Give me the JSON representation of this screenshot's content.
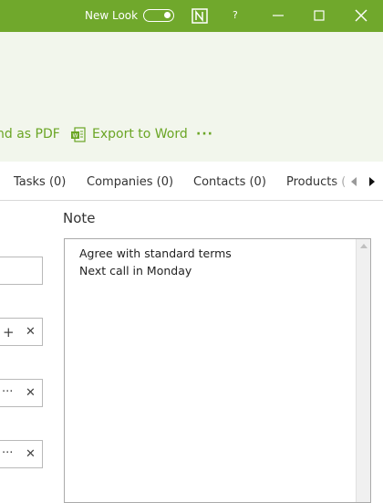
{
  "titlebar": {
    "new_look_label": "New Look",
    "new_look_on": true,
    "help_label": "?",
    "brand_icon": "onenote-like-n-icon",
    "bg_color": "#70a82c"
  },
  "ribbon": {
    "send_pdf_label": "nd as PDF",
    "export_word_label": "Export to Word",
    "more_label": "···",
    "accent_color": "#6aa524"
  },
  "tabs": [
    {
      "label": "Tasks (0)"
    },
    {
      "label": "Companies (0)"
    },
    {
      "label": "Contacts (0)"
    },
    {
      "label": "Products ("
    }
  ],
  "fields": {
    "row2_add": "+",
    "row2_clear": "✕",
    "row3_more": "···",
    "row3_clear": "✕",
    "row4_more": "···",
    "row4_clear": "✕"
  },
  "note": {
    "label": "Note",
    "lines": [
      "Agree with standard terms",
      "Next call in Monday"
    ]
  }
}
